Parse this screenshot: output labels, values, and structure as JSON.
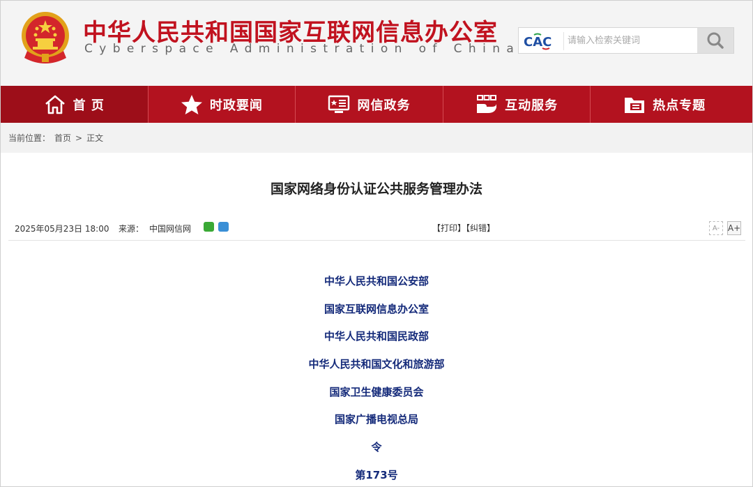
{
  "header": {
    "title_cn": "中华人民共和国国家互联网信息办公室",
    "title_en": "Cyberspace Administration of China",
    "emblem_icon": "national-emblem-icon",
    "search": {
      "logo_text": "CAC",
      "placeholder": "请输入检索关键词",
      "button_icon": "search-icon"
    }
  },
  "nav": {
    "items": [
      {
        "label": "首 页",
        "icon": "home-icon"
      },
      {
        "label": "时政要闻",
        "icon": "star-icon"
      },
      {
        "label": "网信政务",
        "icon": "monitor-icon"
      },
      {
        "label": "互动服务",
        "icon": "interaction-icon"
      },
      {
        "label": "热点专题",
        "icon": "folder-icon"
      }
    ]
  },
  "breadcrumb": {
    "prefix": "当前位置：",
    "home": "首页",
    "separator": ">",
    "current": "正文"
  },
  "article": {
    "title": "国家网络身份认证公共服务管理办法",
    "date": "2025年05月23日 18:00",
    "source_label": "来源：",
    "source": "中国网信网",
    "print": "【打印】",
    "correction": "【纠错】",
    "font_smaller": "A-",
    "font_larger": "A+",
    "departments": [
      "中华人民共和国公安部",
      "国家互联网信息办公室",
      "中华人民共和国民政部",
      "中华人民共和国文化和旅游部",
      "国家卫生健康委员会",
      "国家广播电视总局",
      "令",
      "第173号"
    ]
  },
  "colors": {
    "brand_red": "#c1121f",
    "nav_red": "#b3121f",
    "dept_blue": "#142a7a"
  }
}
